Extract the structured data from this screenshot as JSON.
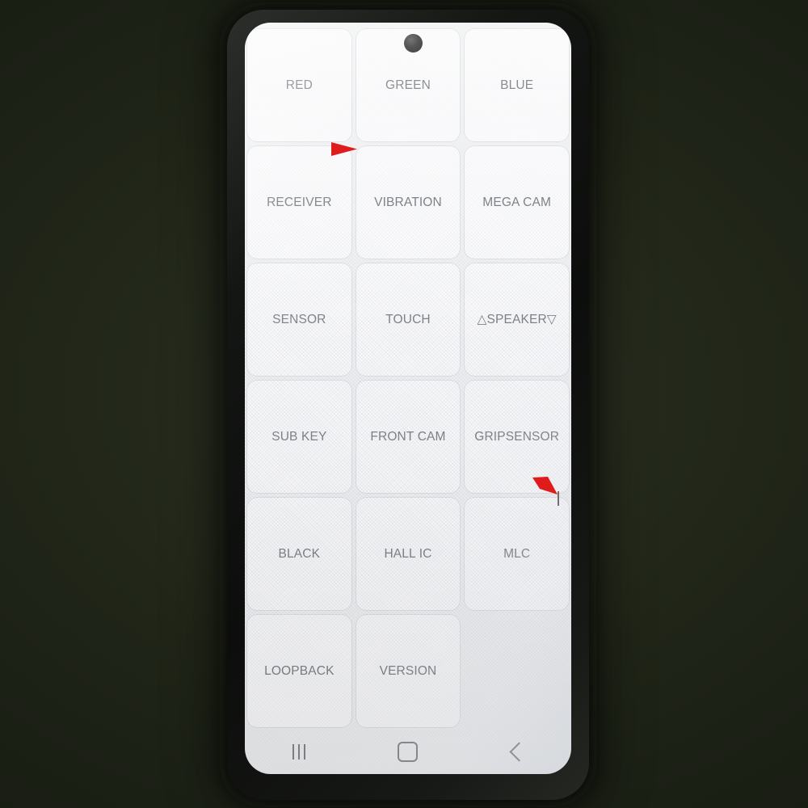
{
  "device": {
    "name": "smartphone",
    "frame_color": "#14160f",
    "screen_bg": "#f1f2f3",
    "camera": "punch-hole-front-camera"
  },
  "screen": {
    "app": "factory-test-menu",
    "grid": {
      "columns": 3,
      "rows": 6,
      "label_color": "#7b7f85",
      "button_color": "#fbfbfc",
      "cells": [
        {
          "label": "RED",
          "name": "test-button-red",
          "empty": false
        },
        {
          "label": "GREEN",
          "name": "test-button-green",
          "empty": false
        },
        {
          "label": "BLUE",
          "name": "test-button-blue",
          "empty": false
        },
        {
          "label": "RECEIVER",
          "name": "test-button-receiver",
          "empty": false
        },
        {
          "label": "VIBRATION",
          "name": "test-button-vibration",
          "empty": false
        },
        {
          "label": "MEGA CAM",
          "name": "test-button-mega-cam",
          "empty": false
        },
        {
          "label": "SENSOR",
          "name": "test-button-sensor",
          "empty": false
        },
        {
          "label": "TOUCH",
          "name": "test-button-touch",
          "empty": false
        },
        {
          "label": "△SPEAKER▽",
          "name": "test-button-speaker",
          "empty": false
        },
        {
          "label": "SUB KEY",
          "name": "test-button-sub-key",
          "empty": false
        },
        {
          "label": "FRONT CAM",
          "name": "test-button-front-cam",
          "empty": false
        },
        {
          "label": "GRIPSENSOR",
          "name": "test-button-gripsensor",
          "empty": false
        },
        {
          "label": "BLACK",
          "name": "test-button-black",
          "empty": false
        },
        {
          "label": "HALL IC",
          "name": "test-button-hall-ic",
          "empty": false
        },
        {
          "label": "MLC",
          "name": "test-button-mlc",
          "empty": false
        },
        {
          "label": "LOOPBACK",
          "name": "test-button-loopback",
          "empty": false
        },
        {
          "label": "VERSION",
          "name": "test-button-version",
          "empty": false
        },
        {
          "label": "",
          "name": "test-button-empty-slot",
          "empty": true
        }
      ]
    },
    "navbar": {
      "recents": "recents-icon",
      "home": "home-icon",
      "back": "back-icon",
      "icon_color": "#83878d"
    }
  },
  "annotations": {
    "color": "#e01b1b",
    "markers": [
      {
        "name": "defect-arrow-upper",
        "direction": "right"
      },
      {
        "name": "defect-arrow-lower",
        "direction": "down-right"
      }
    ],
    "defect": {
      "name": "display-defect-line",
      "color": "#60504e"
    }
  }
}
